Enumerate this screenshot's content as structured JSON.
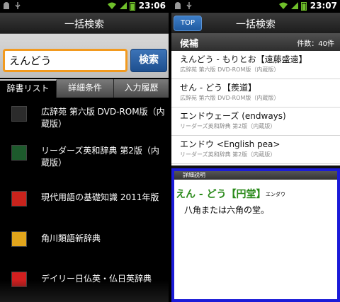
{
  "status_time_left": "23:06",
  "status_time_right": "23:07",
  "left": {
    "title": "一括検索",
    "search": {
      "value": "えんどう",
      "button": "検索"
    },
    "tabs": [
      "辞書リスト",
      "詳細条件",
      "入力履歴"
    ],
    "dictionaries": [
      {
        "label": "広辞苑 第六版 DVD-ROM版（内蔵版）",
        "icon": "kojien-icon",
        "color": "#2b2b2b"
      },
      {
        "label": "リーダーズ英和辞典 第2版（内蔵版）",
        "icon": "readers-icon",
        "color": "#1d5a2c"
      },
      {
        "label": "現代用語の基礎知識 2011年版",
        "icon": "gendai-yogo-icon",
        "color": "#c8231c"
      },
      {
        "label": "角川類語新辞典",
        "icon": "kadokawa-ruigo-icon",
        "color": "#e1a51c"
      },
      {
        "label": "デイリー日仏英・仏日英辞典",
        "icon": "daily-dict-icon",
        "color": "#d11f1f"
      }
    ]
  },
  "right": {
    "top_button": "TOP",
    "title": "一括検索",
    "candidates_title": "候補",
    "candidates_count": "件数：40件",
    "candidates": [
      {
        "main": "えんどう - もりとお【遠藤盛遠】",
        "sub": "広辞苑 第六版 DVD-ROM版（内蔵版）"
      },
      {
        "main": "せん - どう【羨道】",
        "sub": "広辞苑 第六版 DVD-ROM版（内蔵版）"
      },
      {
        "main": "エンドウェーズ (endways)",
        "sub": "リーダーズ英和辞典 第2版（内蔵版）"
      },
      {
        "main": "エンドウ <English pea>",
        "sub": "リーダーズ英和辞典 第2版（内蔵版）"
      }
    ],
    "detail": {
      "header": "詳細説明",
      "head_word": "えん - どう【円堂】",
      "reading": "エンダウ",
      "body": "八角または六角の堂。"
    }
  }
}
